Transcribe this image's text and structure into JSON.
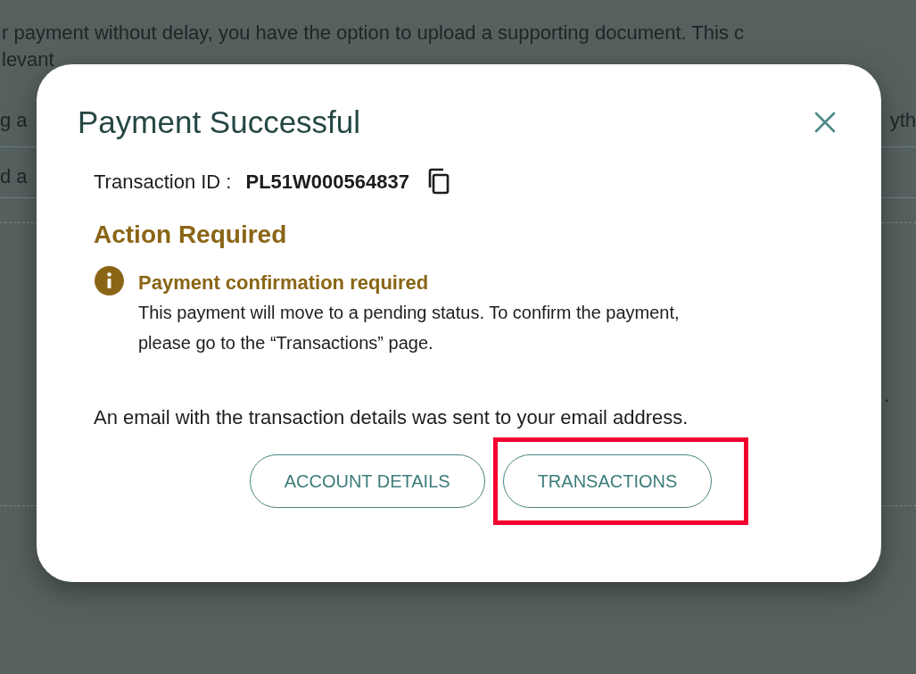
{
  "background": {
    "line_1": "r payment without delay, you have the option to upload a supporting document. This c",
    "line_2": "levant",
    "fragment_left_1": "g a",
    "fragment_right_1": "yth",
    "fragment_left_2": "d a",
    "fragment_right_2": "."
  },
  "modal": {
    "title": "Payment Successful",
    "transaction": {
      "label": "Transaction ID :",
      "value": "PL51W000564837"
    },
    "action_title": "Action Required",
    "alert": {
      "title": "Payment confirmation required",
      "text": "This payment will move to a pending status. To confirm the payment, please go to the “Transactions” page."
    },
    "note": "An email with the transaction details was sent to your email address.",
    "buttons": [
      {
        "label": "ACCOUNT DETAILS",
        "highlighted": false
      },
      {
        "label": "TRANSACTIONS",
        "highlighted": true
      }
    ]
  }
}
